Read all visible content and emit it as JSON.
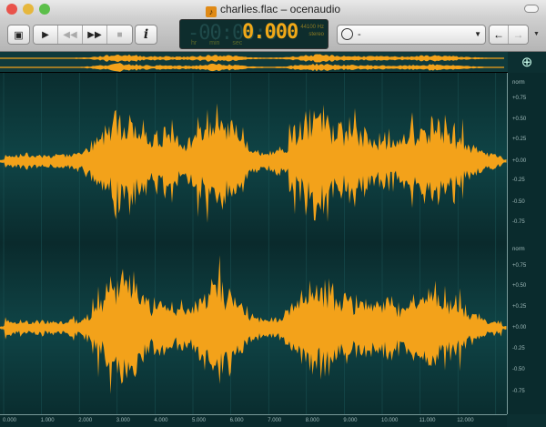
{
  "window": {
    "title": "charlies.flac – ocenaudio",
    "traffic_lights": [
      "#e9534b",
      "#e6b73d",
      "#5cbf4a"
    ]
  },
  "toolbar": {
    "buttons": [
      {
        "name": "toggle-panel",
        "icon": "panel-icon",
        "glyph": "▣"
      },
      {
        "name": "play",
        "icon": "play-icon",
        "glyph": "▶"
      },
      {
        "name": "rewind",
        "icon": "rewind-icon",
        "glyph": "◀◀"
      },
      {
        "name": "fast-forward",
        "icon": "fast-forward-icon",
        "glyph": "▶▶"
      },
      {
        "name": "stop",
        "icon": "stop-icon",
        "glyph": "■"
      },
      {
        "name": "info",
        "icon": "info-icon",
        "glyph": "i"
      }
    ],
    "time_ghost": "-00:00:0",
    "time": "0.000",
    "time_units": "hr min sec",
    "sample_rate": "44100 Hz",
    "channels": "stereo",
    "history_value": "-",
    "back_glyph": "←",
    "forward_glyph": "→"
  },
  "colors": {
    "waveform": "#f3a21a",
    "background": "#0c3b3d"
  },
  "scale": {
    "channel1": [
      "norm",
      "+0.75",
      "+0.50",
      "+0.25",
      "+0.00",
      "-0.25",
      "-0.50",
      "-0.75"
    ],
    "channel2": [
      "norm",
      "+0.75",
      "+0.50",
      "+0.25",
      "+0.00",
      "-0.25",
      "-0.50",
      "-0.75"
    ]
  },
  "ruler": [
    "0.000",
    "1.000",
    "2.000",
    "3.000",
    "4.000",
    "5.000",
    "6.000",
    "7.000",
    "8.000",
    "9.000",
    "10.000",
    "11.000",
    "12.000"
  ]
}
